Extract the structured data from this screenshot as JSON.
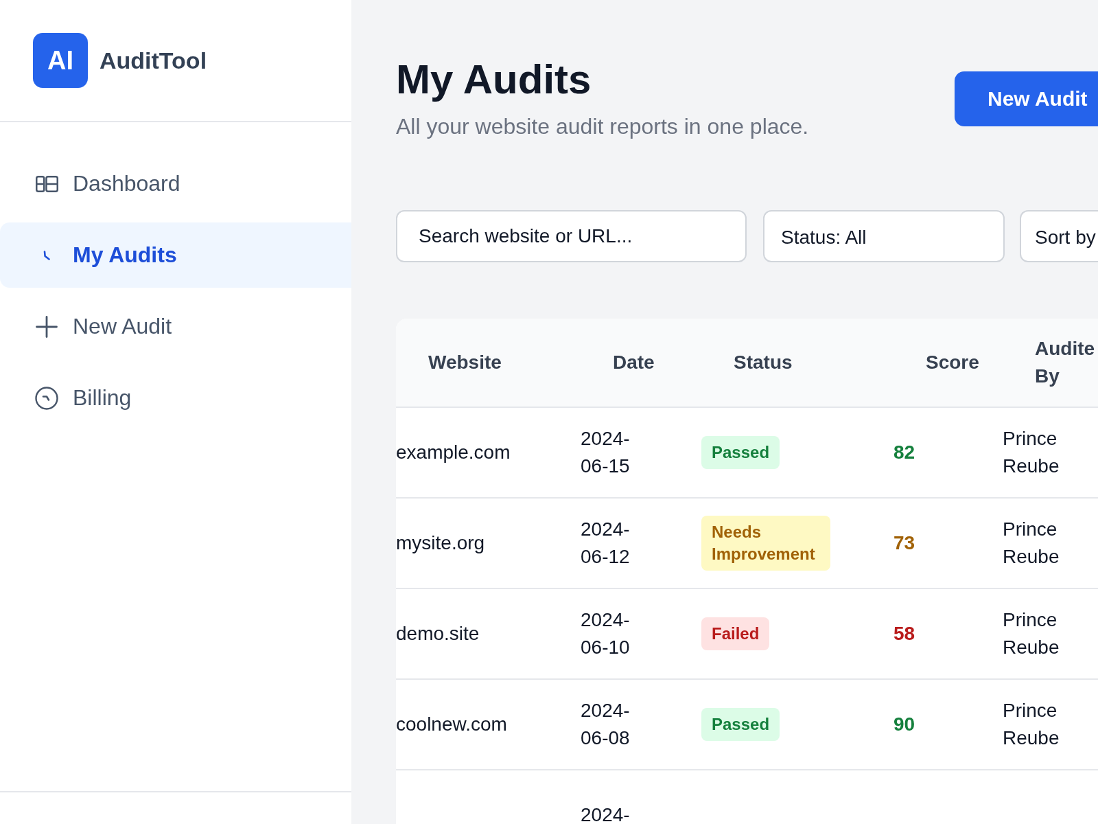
{
  "sidebar": {
    "logo": {
      "mark": "AI",
      "name": "AuditTool"
    },
    "items": [
      {
        "label": "Dashboard",
        "selected": false
      },
      {
        "label": "My Audits",
        "selected": true
      },
      {
        "label": "New Audit",
        "selected": false
      },
      {
        "label": "Billing",
        "selected": false
      }
    ]
  },
  "page": {
    "title": "My Audits",
    "subtitle": "All your website audit reports in one place.",
    "primary_button": "New Audit"
  },
  "filters": {
    "search": {
      "placeholder": "Search website or URL..."
    },
    "status": {
      "value": "Status: All"
    },
    "sort": {
      "value": "Sort by"
    }
  },
  "table": {
    "columns": [
      "Website",
      "Date",
      "Status",
      "Score",
      "Audite By"
    ],
    "rows": [
      {
        "website": "example.com",
        "date": "2024-06-15",
        "status": {
          "kind": "passed",
          "label": "Passed"
        },
        "score": "82",
        "audited_by": "Prince Reube"
      },
      {
        "website": "mysite.org",
        "date": "2024-06-12",
        "status": {
          "kind": "needs_improvement",
          "label": "Needs Improvement"
        },
        "score": "73",
        "audited_by": "Prince Reube"
      },
      {
        "website": "demo.site",
        "date": "2024-06-10",
        "status": {
          "kind": "failed",
          "label": "Failed"
        },
        "score": "58",
        "audited_by": "Prince Reube"
      },
      {
        "website": "coolnew.com",
        "date": "2024-06-08",
        "status": {
          "kind": "passed",
          "label": "Passed"
        },
        "score": "90",
        "audited_by": "Prince Reube"
      },
      {
        "date": "2024-"
      }
    ]
  }
}
